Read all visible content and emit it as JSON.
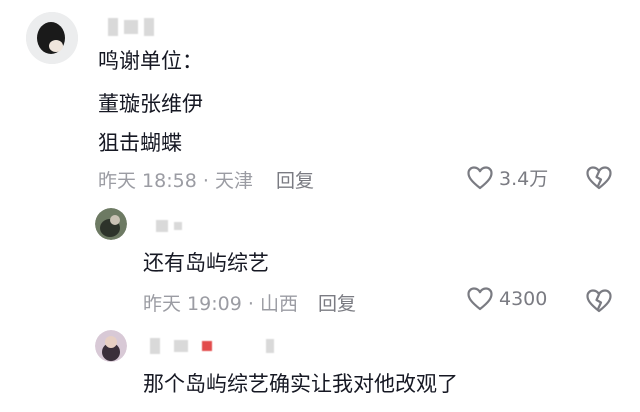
{
  "comments": [
    {
      "lines": [
        "鸣谢单位：",
        "董璇张维伊",
        "狙击蝴蝶"
      ],
      "time": "昨天 18:58",
      "location": "天津",
      "reply_label": "回复",
      "likes": "3.4万"
    },
    {
      "lines": [
        "还有岛屿综艺"
      ],
      "time": "昨天 19:09",
      "location": "山西",
      "reply_label": "回复",
      "likes": "4300"
    },
    {
      "lines": [
        "那个岛屿综艺确实让我对他改观了"
      ]
    }
  ],
  "icons": {
    "like": "heart-outline-icon",
    "dislike": "broken-heart-icon"
  },
  "colors": {
    "meta_text": "#9b9ca3",
    "body_text": "#161823"
  }
}
